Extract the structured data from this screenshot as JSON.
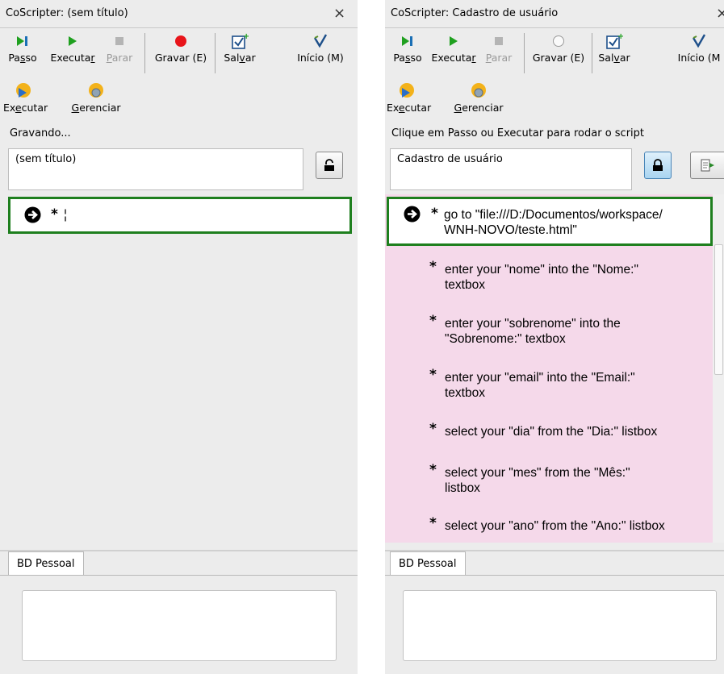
{
  "left": {
    "title": "CoScripter: (sem título)",
    "close": "×",
    "toolbar": {
      "passo": {
        "pre": "Pa",
        "key": "s",
        "post": "so"
      },
      "executar": {
        "pre": "Executa",
        "key": "r",
        "post": ""
      },
      "parar": {
        "pre": "",
        "key": "P",
        "post": "arar"
      },
      "gravar": "Gravar (E)",
      "salvar": {
        "pre": "Sal",
        "key": "v",
        "post": "ar"
      },
      "inicio": "Início (M)"
    },
    "row2": {
      "executar": {
        "pre": "Ex",
        "key": "e",
        "post": "cutar"
      },
      "gerenciar": {
        "pre": "",
        "key": "G",
        "post": "erenciar"
      }
    },
    "status": "Gravando...",
    "script_name": "(sem título)",
    "steps": [
      {
        "star": "*",
        "text": "¦"
      }
    ],
    "bd_tab": "BD Pessoal"
  },
  "right": {
    "title": "CoScripter: Cadastro de usuário",
    "close": "×",
    "toolbar": {
      "passo": {
        "pre": "Pa",
        "key": "s",
        "post": "so"
      },
      "executar": {
        "pre": "Executa",
        "key": "r",
        "post": ""
      },
      "parar": {
        "pre": "",
        "key": "P",
        "post": "arar"
      },
      "gravar": "Gravar (E)",
      "salvar": {
        "pre": "Sal",
        "key": "v",
        "post": "ar"
      },
      "inicio": "Início (M"
    },
    "row2": {
      "executar": {
        "pre": "Ex",
        "key": "e",
        "post": "cutar"
      },
      "gerenciar": {
        "pre": "",
        "key": "G",
        "post": "erenciar"
      }
    },
    "status": "Clique em Passo ou Executar para rodar o script",
    "script_name": "Cadastro de usuário",
    "steps": [
      {
        "star": "*",
        "line1": "go to \"file:///D:/Documentos/workspace/",
        "line2": "WNH-NOVO/teste.html\""
      },
      {
        "star": "*",
        "line1": "enter your \"nome\" into the \"Nome:\"",
        "line2": "textbox"
      },
      {
        "star": "*",
        "line1": "enter your \"sobrenome\" into the",
        "line2": "\"Sobrenome:\" textbox"
      },
      {
        "star": "*",
        "line1": "enter your \"email\" into the \"Email:\"",
        "line2": "textbox"
      },
      {
        "star": "*",
        "line1": "select your \"dia\" from the \"Dia:\" listbox",
        "line2": ""
      },
      {
        "star": "*",
        "line1": "select your \"mes\" from the \"Mês:\"",
        "line2": "listbox"
      },
      {
        "star": "*",
        "line1": "select your \"ano\" from the \"Ano:\" listbox",
        "line2": ""
      }
    ],
    "bd_tab": "BD Pessoal"
  },
  "colors": {
    "current_step_border": "#1e7f1e",
    "unexecuted_step_bg": "#f5d9ea",
    "record_red": "#e8141a",
    "play_green": "#1fa01f"
  },
  "icons": {
    "passo": "step-icon",
    "executar": "play-icon",
    "parar": "stop-icon",
    "gravar": "record-icon",
    "salvar": "save-icon",
    "inicio": "home-icon",
    "executar2": "run-script-icon",
    "gerenciar": "manage-icon",
    "lock": "lock-icon",
    "export": "export-icon",
    "current": "current-step-arrow-icon"
  }
}
